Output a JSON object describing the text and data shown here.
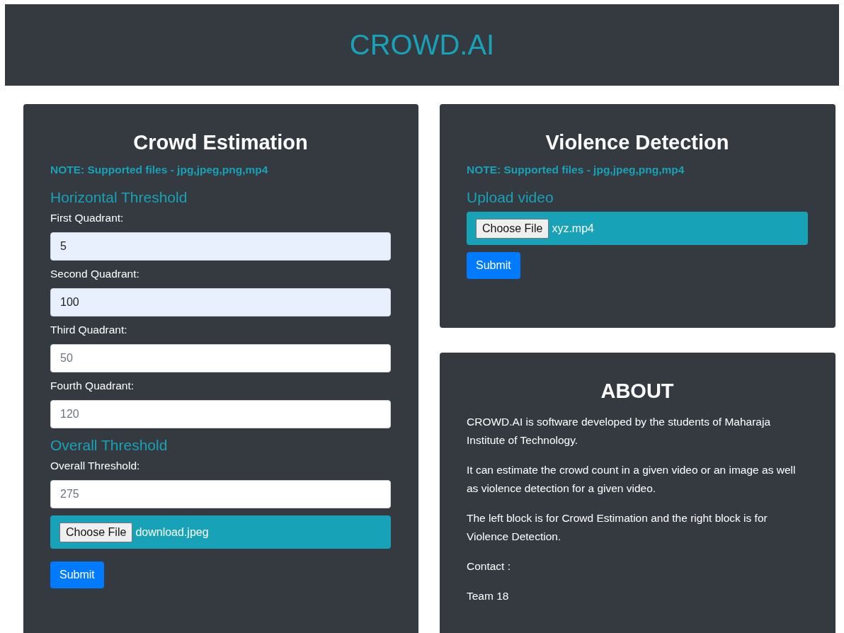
{
  "header": {
    "title": "CROWD.AI"
  },
  "crowd_estimation": {
    "title": "Crowd Estimation",
    "note": "NOTE: Supported files - jpg,jpeg,png,mp4",
    "sections": [
      {
        "heading": "Horizontal Threshold",
        "fields": [
          {
            "label": "First Quadrant:",
            "value": "5",
            "autofilled": true
          },
          {
            "label": "Second Quadrant:",
            "value": "100",
            "autofilled": true
          },
          {
            "label": "Third Quadrant:",
            "placeholder": "50",
            "autofilled": false
          },
          {
            "label": "Fourth Quadrant:",
            "placeholder": "120",
            "autofilled": false
          }
        ]
      },
      {
        "heading": "Overall Threshold",
        "fields": [
          {
            "label": "Overall Threshold:",
            "placeholder": "275",
            "autofilled": false
          }
        ]
      }
    ],
    "file_input": {
      "button": "Choose File",
      "file_name": "download.jpeg"
    },
    "submit": "Submit"
  },
  "violence_detection": {
    "title": "Violence Detection",
    "note": "NOTE: Supported files - jpg,jpeg,png,mp4",
    "heading": "Upload video",
    "file_input": {
      "button": "Choose File",
      "file_name": "xyz.mp4"
    },
    "submit": "Submit"
  },
  "about": {
    "title": "ABOUT",
    "paragraphs": [
      "CROWD.AI is software developed by the students of Maharaja Institute of Technology.",
      "It can estimate the crowd count in a given video or an image as well as violence detection for a given video.",
      "The left block is for Crowd Estimation and the right block is for Violence Detection.",
      "Contact :",
      "Team 18"
    ]
  }
}
